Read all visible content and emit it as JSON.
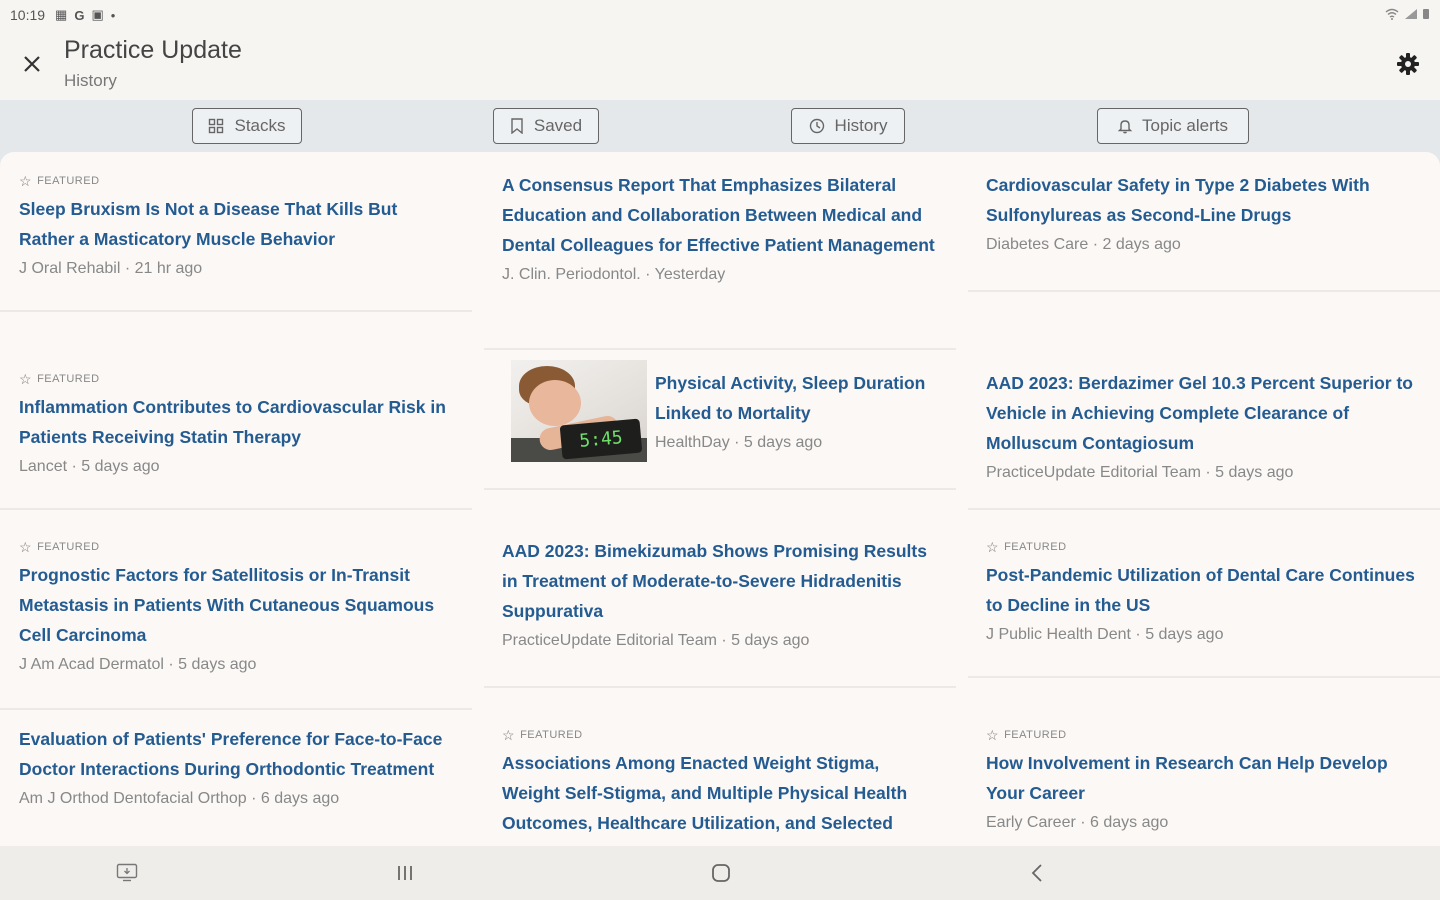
{
  "status_bar": {
    "time": "10:19",
    "icons": [
      "grid-icon",
      "google-icon",
      "news-icon",
      "dot-icon"
    ],
    "right_icons": [
      "wifi-icon",
      "signal-icon",
      "battery-icon"
    ],
    "right_text": "∶·▮"
  },
  "header": {
    "title": "Practice Update",
    "subtitle": "History",
    "close_icon": "close-icon",
    "settings_icon": "gear-icon"
  },
  "tabs": [
    {
      "label": "Stacks",
      "icon": "grid-icon"
    },
    {
      "label": "Saved",
      "icon": "bookmark-icon"
    },
    {
      "label": "History",
      "icon": "history-icon"
    },
    {
      "label": "Topic alerts",
      "icon": "bell-icon"
    }
  ],
  "featured_label": "FEATURED",
  "articles": [
    {
      "featured": true,
      "title": "Sleep Bruxism Is Not a Disease That Kills But Rather a Masticatory Muscle Behavior",
      "source": "J Oral Rehabil",
      "time": "21 hr ago"
    },
    {
      "featured": true,
      "title": "Inflammation Contributes to Cardiovascular Risk in Patients Receiving Statin Therapy",
      "source": "Lancet",
      "time": "5 days ago"
    },
    {
      "featured": true,
      "title": "Prognostic Factors for Satellitosis or In-Transit Metastasis in Patients With Cutaneous Squamous Cell Carcinoma",
      "source": "J Am Acad Dermatol",
      "time": "5 days ago"
    },
    {
      "featured": false,
      "title": "Evaluation of Patients' Preference for Face-to-Face Doctor Interactions During Orthodontic Treatment",
      "source": "Am J Orthod Dentofacial Orthop",
      "time": "6 days ago"
    },
    {
      "featured": false,
      "title": "A Consensus Report That Emphasizes Bilateral Education and Collaboration Between Medical and Dental Colleagues for Effective Patient Management",
      "source": "J. Clin. Periodontol.",
      "time": "Yesterday"
    },
    {
      "featured": false,
      "title": "Physical Activity, Sleep Duration Linked to Mortality",
      "source": "HealthDay",
      "time": "5 days ago",
      "image": "alarm-clock-sleep-photo",
      "clock_text": "5:45"
    },
    {
      "featured": false,
      "title": "AAD 2023: Bimekizumab Shows Promising Results in Treatment of Moderate-to-Severe Hidradenitis Suppurativa",
      "source": "PracticeUpdate Editorial Team",
      "time": "5 days ago"
    },
    {
      "featured": true,
      "title": "Associations Among Enacted Weight Stigma, Weight Self-Stigma, and Multiple Physical Health Outcomes, Healthcare Utilization, and Selected Health Behaviors",
      "source": "",
      "time": ""
    },
    {
      "featured": false,
      "title": "Cardiovascular Safety in Type 2 Diabetes With Sulfonylureas as Second-Line Drugs",
      "source": "Diabetes Care",
      "time": "2 days ago"
    },
    {
      "featured": false,
      "title": "AAD 2023: Berdazimer Gel 10.3 Percent Superior to Vehicle in Achieving Complete Clearance of Molluscum Contagiosum",
      "source": "PracticeUpdate Editorial Team",
      "time": "5 days ago"
    },
    {
      "featured": true,
      "title": "Post-Pandemic Utilization of Dental Care Continues to Decline in the US",
      "source": "J Public Health Dent",
      "time": "5 days ago"
    },
    {
      "featured": true,
      "title": "How Involvement in Research Can Help Develop Your Career",
      "source": "Early Career",
      "time": "6 days ago"
    }
  ],
  "nav": {
    "buttons": [
      "keyboard-icon",
      "recents-icon",
      "home-icon",
      "back-icon"
    ]
  },
  "colors": {
    "headline": "#245b91",
    "background": "#fbf8f6",
    "tabbar": "#e4e8eb"
  }
}
